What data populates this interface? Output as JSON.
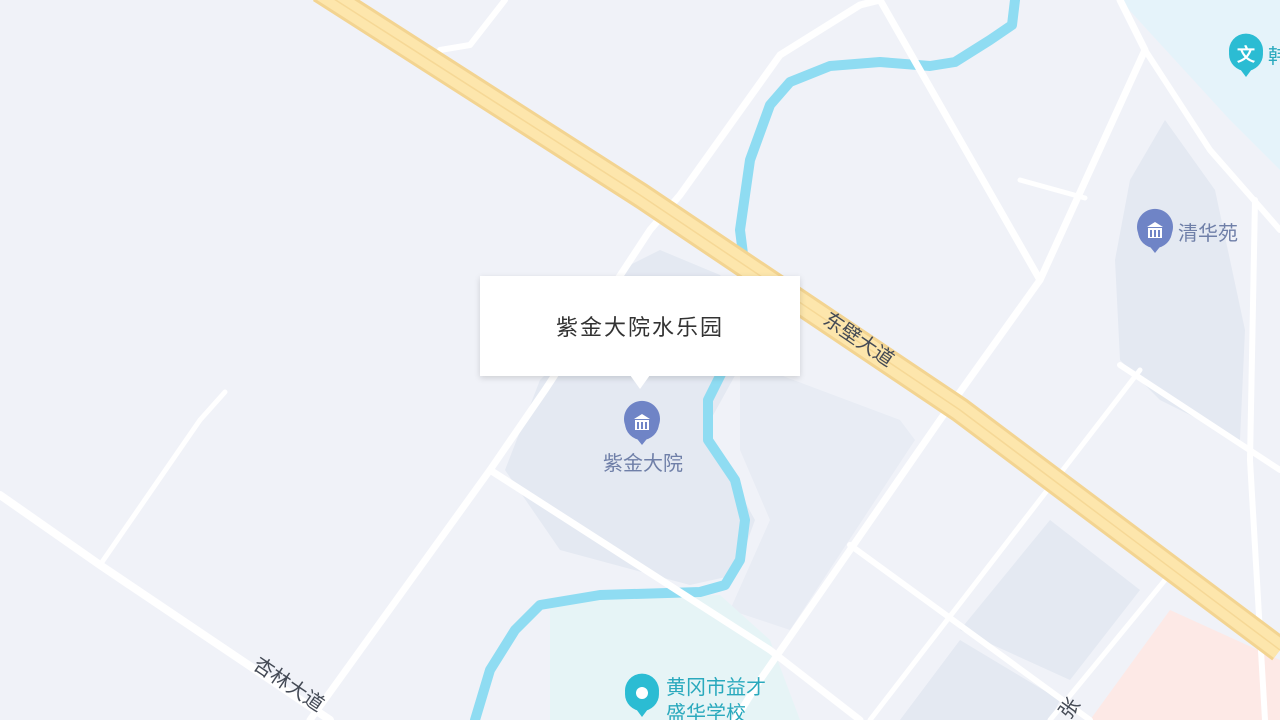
{
  "map": {
    "popup": {
      "title": "紫金大院水乐园"
    },
    "roads": {
      "main_road": "东壁大道",
      "xinglin_road": "杏林大道",
      "partial_road": "张"
    },
    "pois": {
      "zijin": {
        "name": "紫金大院",
        "icon": "building-icon"
      },
      "qinghua": {
        "name": "清华苑",
        "icon": "building-icon"
      },
      "school_line1": "黄冈市益才",
      "school_line2": "盛华学校",
      "school_icon": "map-pin-icon",
      "culture_partial": "韩",
      "culture_icon": "culture-icon",
      "culture_glyph": "文"
    },
    "colors": {
      "background": "#f0f2f8",
      "block": "#e4e9f2",
      "highway_fill": "#fde6ac",
      "highway_edge": "#f3d491",
      "road": "#ffffff",
      "river": "#8fdcf2",
      "poi_building": "#6f84c6",
      "poi_school": "#2bbcd3",
      "poi_label": "#6f7fa8",
      "school_label": "#2aa9bd",
      "culture_area": "#e5f3fa",
      "pink_area": "#fde9e6",
      "green_area": "#e6f4f6"
    }
  }
}
